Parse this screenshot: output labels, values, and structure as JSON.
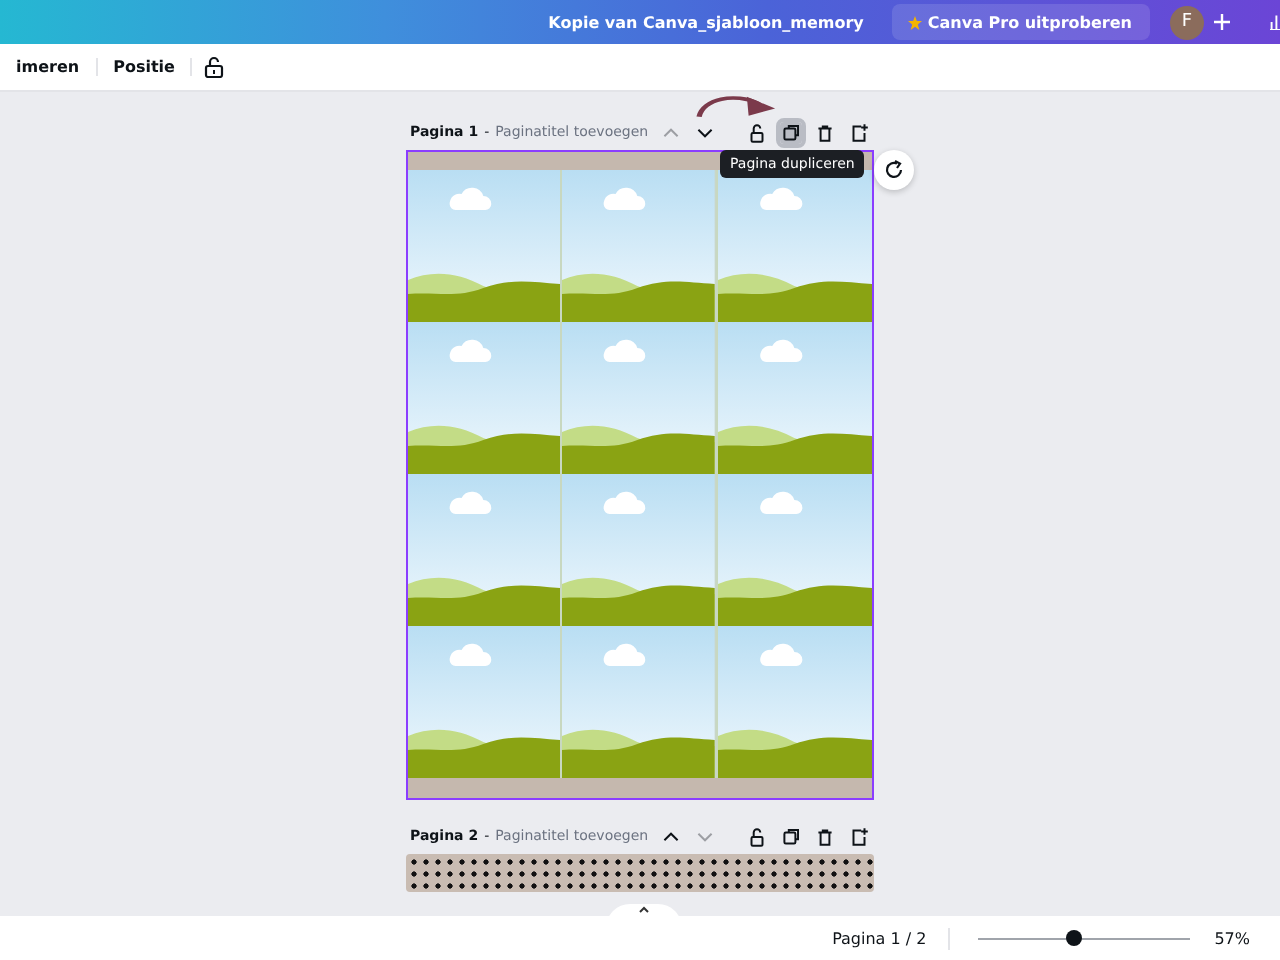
{
  "topbar": {
    "title": "Kopie van Canva_sjabloon_memory",
    "pro_button": "Canva Pro uitproberen",
    "avatar": "F"
  },
  "toolbar": {
    "items": [
      "imeren",
      "Positie"
    ],
    "locked": false
  },
  "pages": [
    {
      "label": "Pagina 1",
      "separator": "-",
      "title_placeholder": "Paginatitel toevoegen",
      "kind": "tiles",
      "selected": true,
      "up_disabled": true,
      "down_disabled": false,
      "duplicate_hovered": true,
      "tooltip": "Pagina dupliceren"
    },
    {
      "label": "Pagina 2",
      "separator": "-",
      "title_placeholder": "Paginatitel toevoegen",
      "kind": "dots",
      "selected": false,
      "up_disabled": false,
      "down_disabled": true,
      "duplicate_hovered": false
    }
  ],
  "footer": {
    "page_indicator": "Pagina 1 / 2",
    "zoom": {
      "level": 0.45
    },
    "zoom_reading": "57%"
  }
}
